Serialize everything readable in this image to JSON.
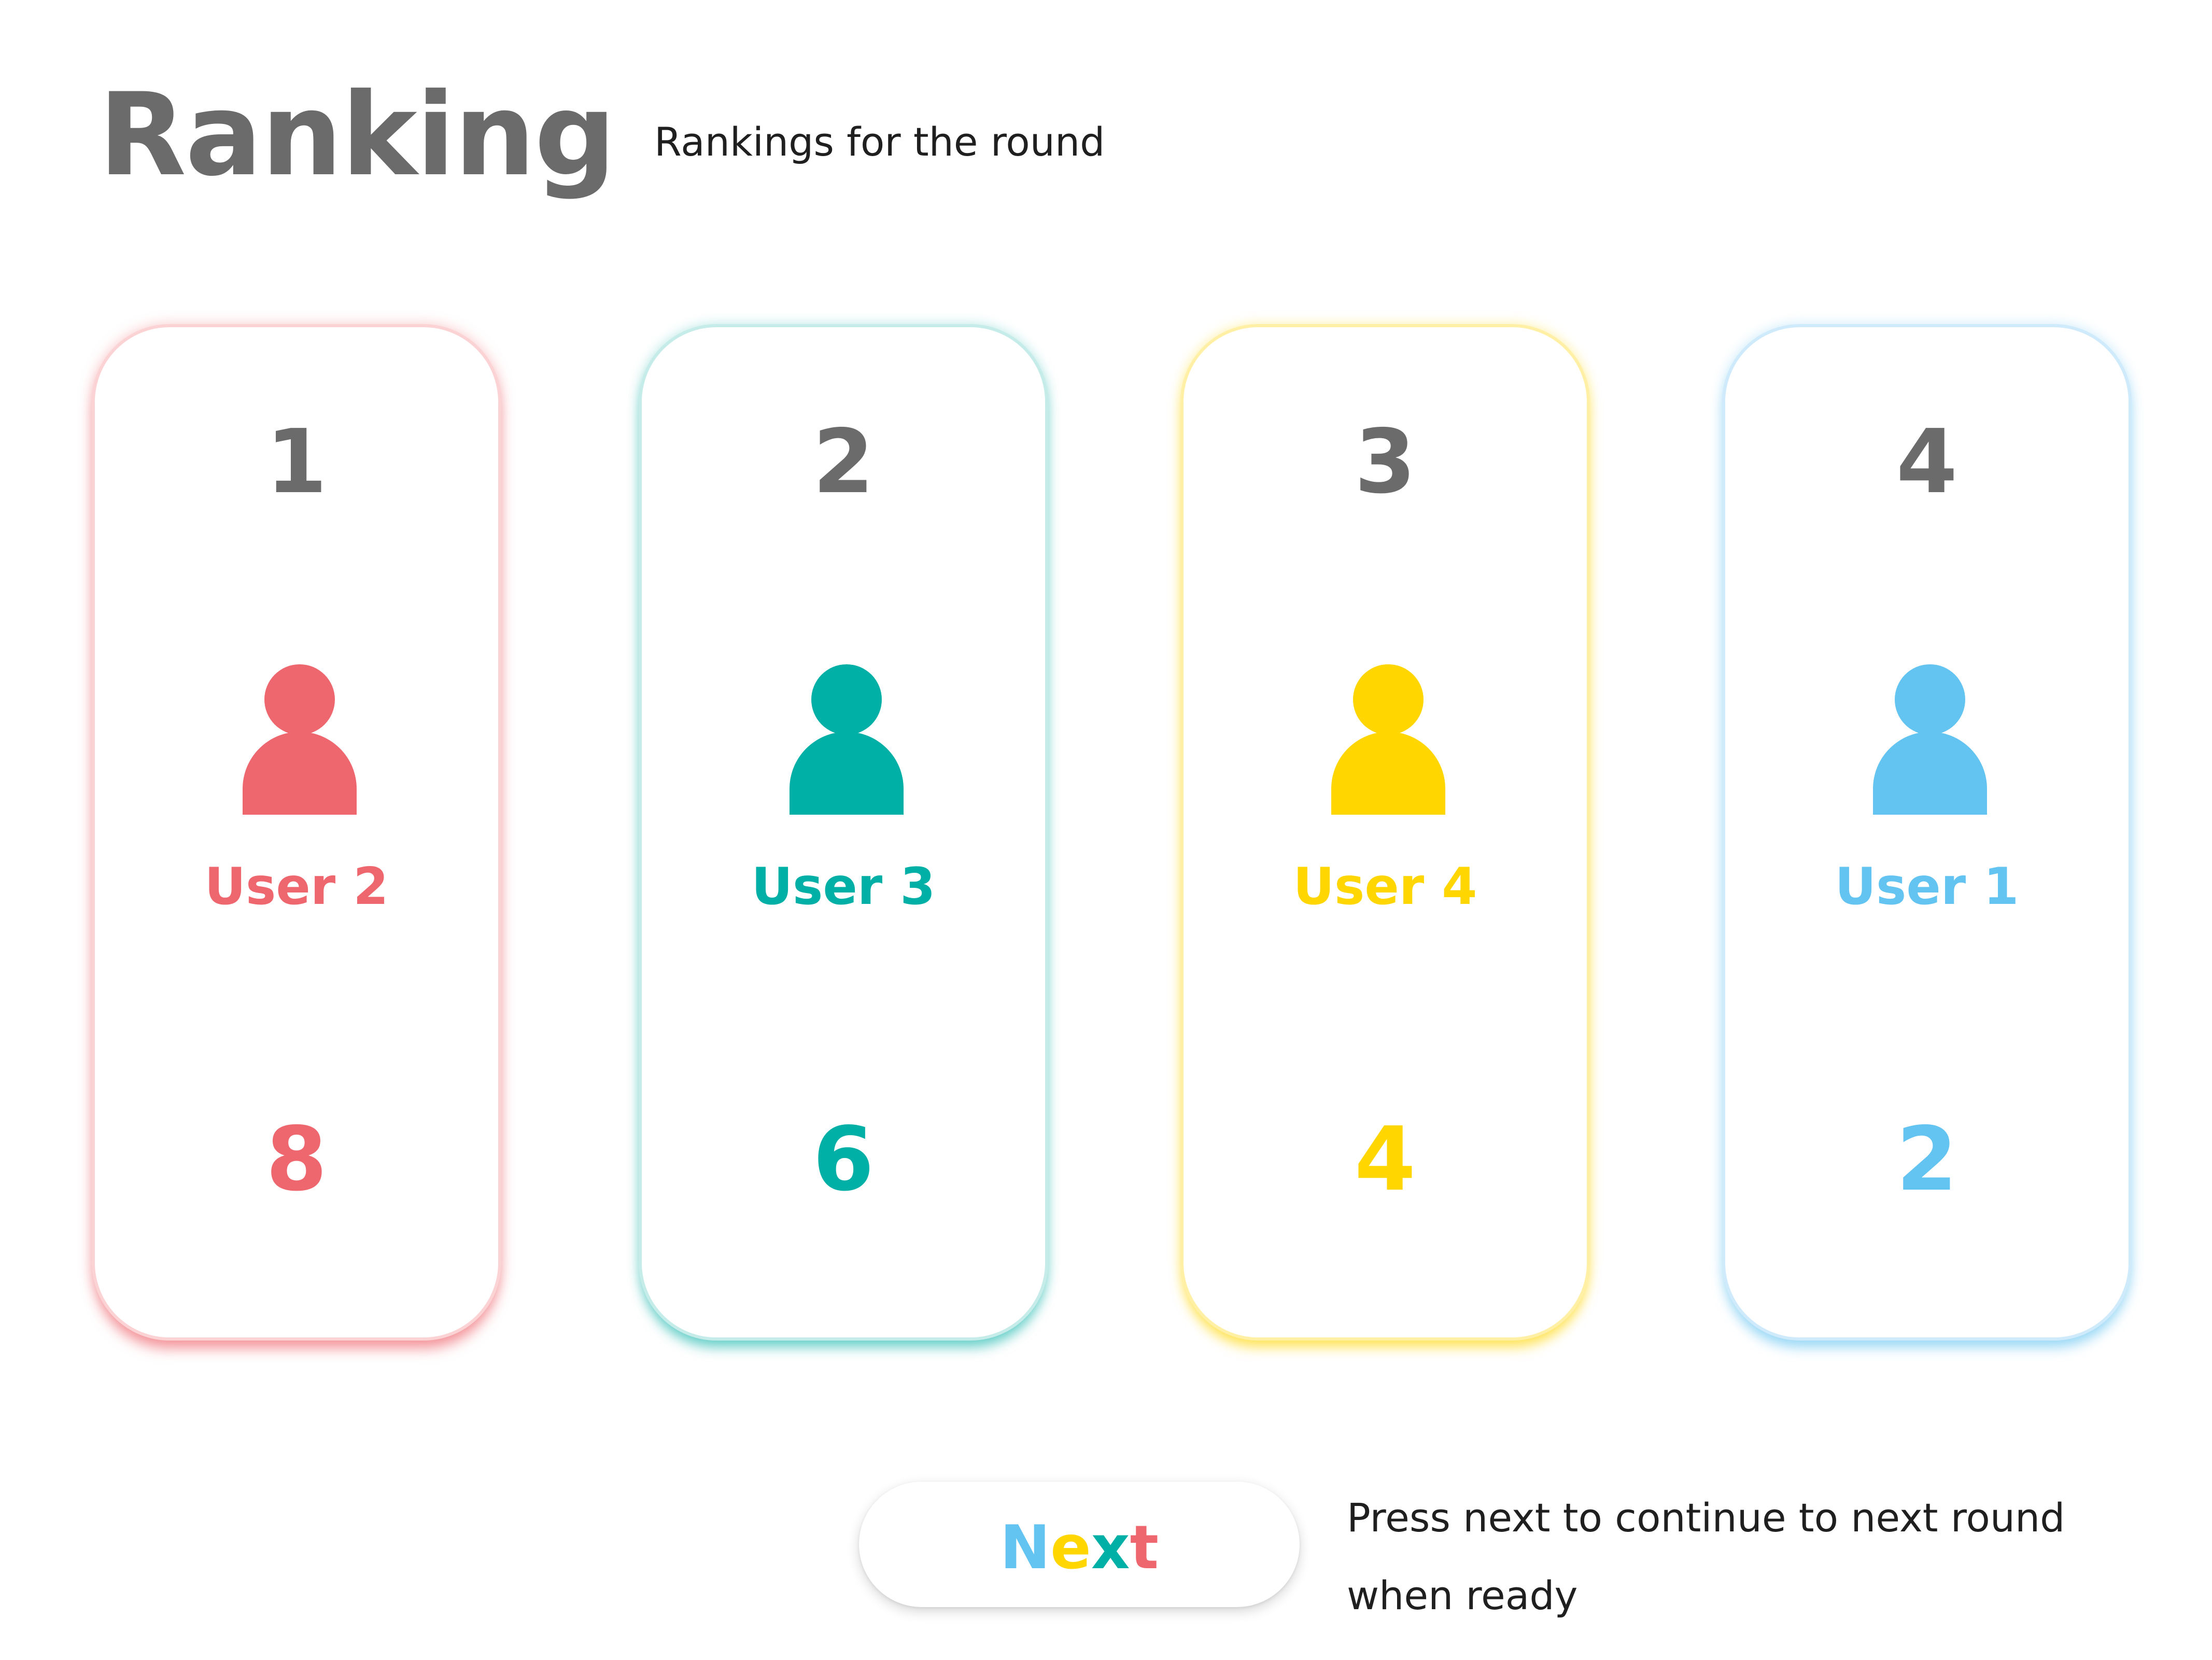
{
  "header": {
    "title": "Ranking",
    "subtitle": "Rankings for the round"
  },
  "cards": [
    {
      "rank": "1",
      "user": "User 2",
      "score": "8",
      "color": "#EE666E",
      "icon": "user-icon"
    },
    {
      "rank": "2",
      "user": "User 3",
      "score": "6",
      "color": "#00B0A6",
      "icon": "user-icon"
    },
    {
      "rank": "3",
      "user": "User 4",
      "score": "4",
      "color": "#FFD600",
      "icon": "user-icon"
    },
    {
      "rank": "4",
      "user": "User 1",
      "score": "2",
      "color": "#63C3F1",
      "icon": "user-icon"
    }
  ],
  "footer": {
    "next_letters": [
      "N",
      "e",
      "x",
      "t"
    ],
    "next_letter_colors": [
      "#63C3F1",
      "#FFD600",
      "#00B0A6",
      "#EE666E"
    ],
    "hint_line_1": "Press next to continue to next round",
    "hint_line_2": "when ready"
  }
}
